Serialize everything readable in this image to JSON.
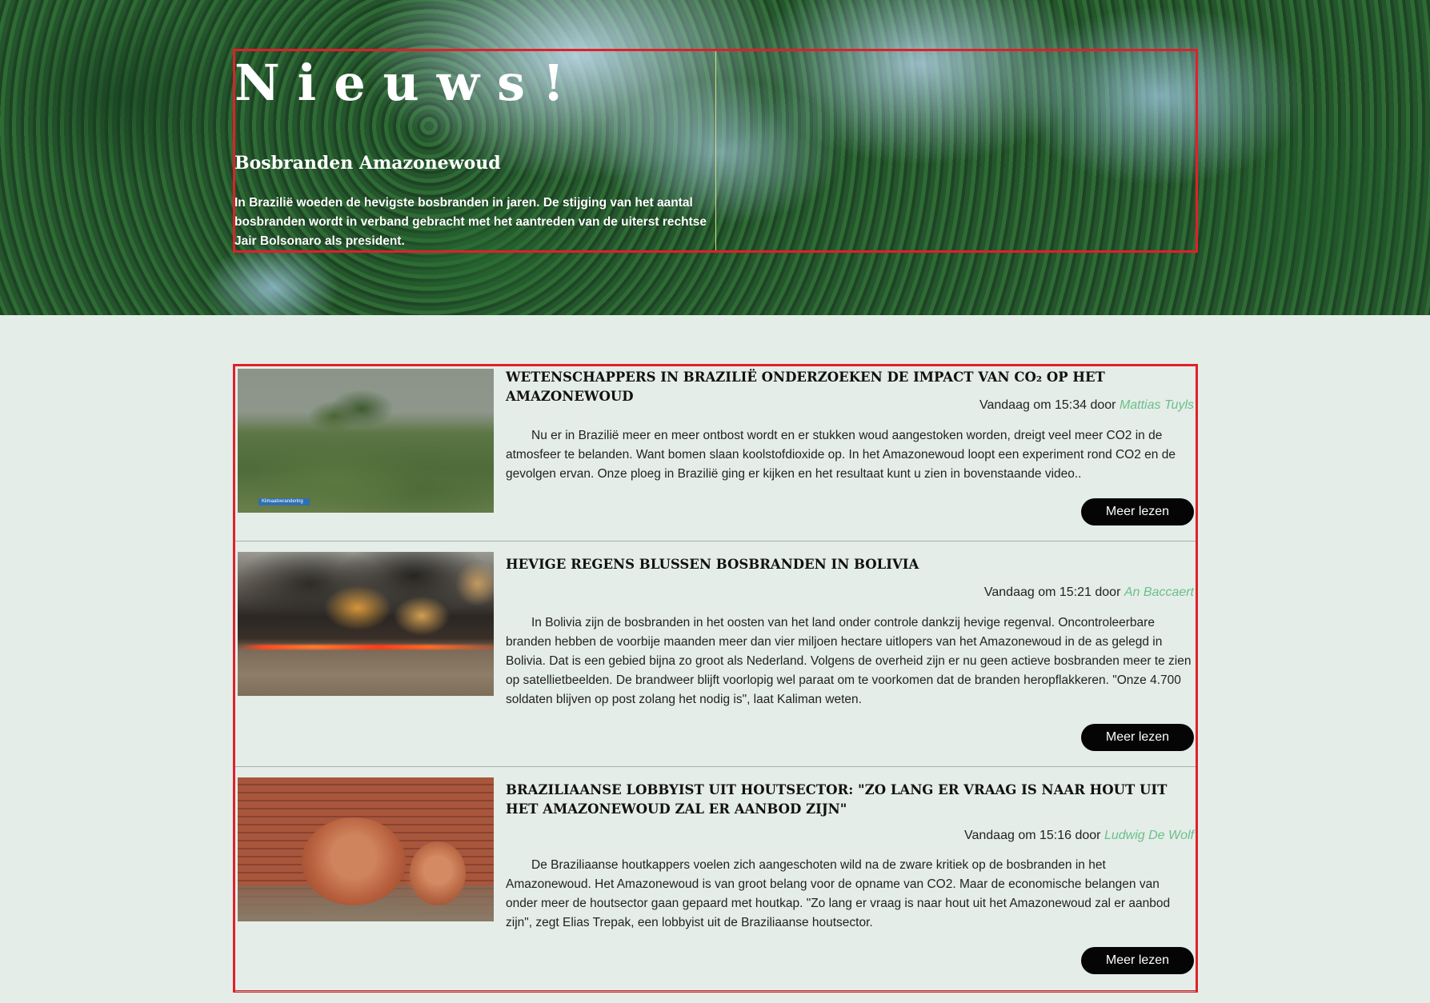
{
  "hero": {
    "title": "Nieuws!",
    "subtitle": "Bosbranden Amazonewoud",
    "text": "In Brazilië woeden de hevigste bosbranden in jaren. De stijging van het aantal bosbranden wordt in verband gebracht met het aantreden van de uiterst rechtse Jair Bolsonaro als president."
  },
  "articles": [
    {
      "title": "Wetenschappers in Brazilië onderzoeken de impact van CO₂ op het Amazonewoud",
      "meta_prefix": "Vandaag om 15:34 door ",
      "author": "Mattias Tuyls",
      "body": "Nu er in Brazilië meer en meer ontbost wordt en er stukken woud aangestoken worden, dreigt veel meer CO2 in de atmosfeer te belanden. Want bomen slaan koolstofdioxide op. In het Amazonewoud loopt een experiment rond CO2 en de gevolgen ervan. Onze ploeg in Brazilië ging er kijken en het resultaat kunt u zien in bovenstaande video..",
      "button": "Meer lezen",
      "image_tag": "Klimaatverandering"
    },
    {
      "title": "Hevige regens blussen bosbranden in Bolivia",
      "meta_prefix": "Vandaag om 15:21 door ",
      "author": "An Baccaert",
      "body": "In Bolivia zijn de bosbranden in het oosten van het land onder controle dankzij hevige regenval. Oncontroleerbare branden hebben de voorbije maanden meer dan vier miljoen hectare uitlopers van het Amazonewoud in de as gelegd in Bolivia. Dat is een gebied bijna zo groot als Nederland. Volgens de overheid zijn er nu geen actieve bosbranden meer te zien op satellietbeelden. De brandweer blijft voorlopig wel paraat om te voorkomen dat de branden heropflakkeren. \"Onze 4.700 soldaten blijven op post zolang het nodig is\", laat Kaliman weten.",
      "button": "Meer lezen"
    },
    {
      "title": "Braziliaanse lobbyist uit houtsector: \"Zo lang er vraag is naar hout uit het Amazonewoud zal er aanbod zijn\"",
      "meta_prefix": "Vandaag om 15:16 door ",
      "author": "Ludwig De Wolf",
      "body": "De Braziliaanse houtkappers voelen zich aangeschoten wild na de zware kritiek op de bosbranden in het Amazonewoud. Het Amazonewoud is van groot belang voor de opname van CO2. Maar de economische belangen van onder meer de houtsector gaan gepaard met houtkap. \"Zo lang er vraag is naar hout uit het Amazonewoud zal er aanbod zijn\", zegt Elias Trepak, een lobbyist uit de Braziliaanse houtsector.",
      "button": "Meer lezen"
    }
  ],
  "colors": {
    "frame": "#e0202a",
    "author": "#6cbf8a",
    "button_bg": "#050505",
    "page_bg": "#e4ede8"
  }
}
